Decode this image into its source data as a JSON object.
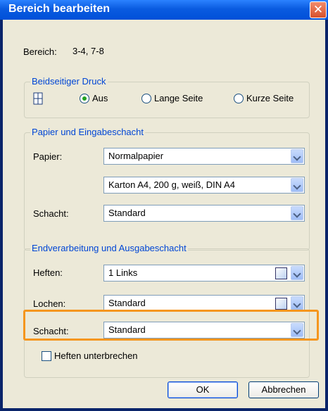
{
  "window": {
    "title": "Bereich bearbeiten",
    "close_glyph": "✕"
  },
  "range": {
    "label": "Bereich:",
    "value": "3-4, 7-8"
  },
  "duplex": {
    "group_label": "Beidseitiger Druck",
    "icon": "page-icon",
    "options": [
      {
        "label": "Aus",
        "selected": true
      },
      {
        "label": "Lange Seite",
        "selected": false
      },
      {
        "label": "Kurze Seite",
        "selected": false
      }
    ]
  },
  "paper": {
    "group_label": "Papier und Eingabeschacht",
    "paper_label": "Papier:",
    "paper_value": "Normalpapier",
    "paper_type_value": "Karton A4, 200 g, weiß, DIN A4",
    "tray_label": "Schacht:",
    "tray_value": "Standard"
  },
  "finishing": {
    "group_label": "Endverarbeitung und Ausgabeschacht",
    "staple_label": "Heften:",
    "staple_value": "1 Links",
    "punch_label": "Lochen:",
    "punch_value": "Standard",
    "output_tray_label": "Schacht:",
    "output_tray_value": "Standard",
    "interrupt_staple_label": "Heften unterbrechen",
    "interrupt_staple_checked": false,
    "highlight_color": "#F5961E"
  },
  "buttons": {
    "ok": "OK",
    "cancel": "Abbrechen"
  }
}
